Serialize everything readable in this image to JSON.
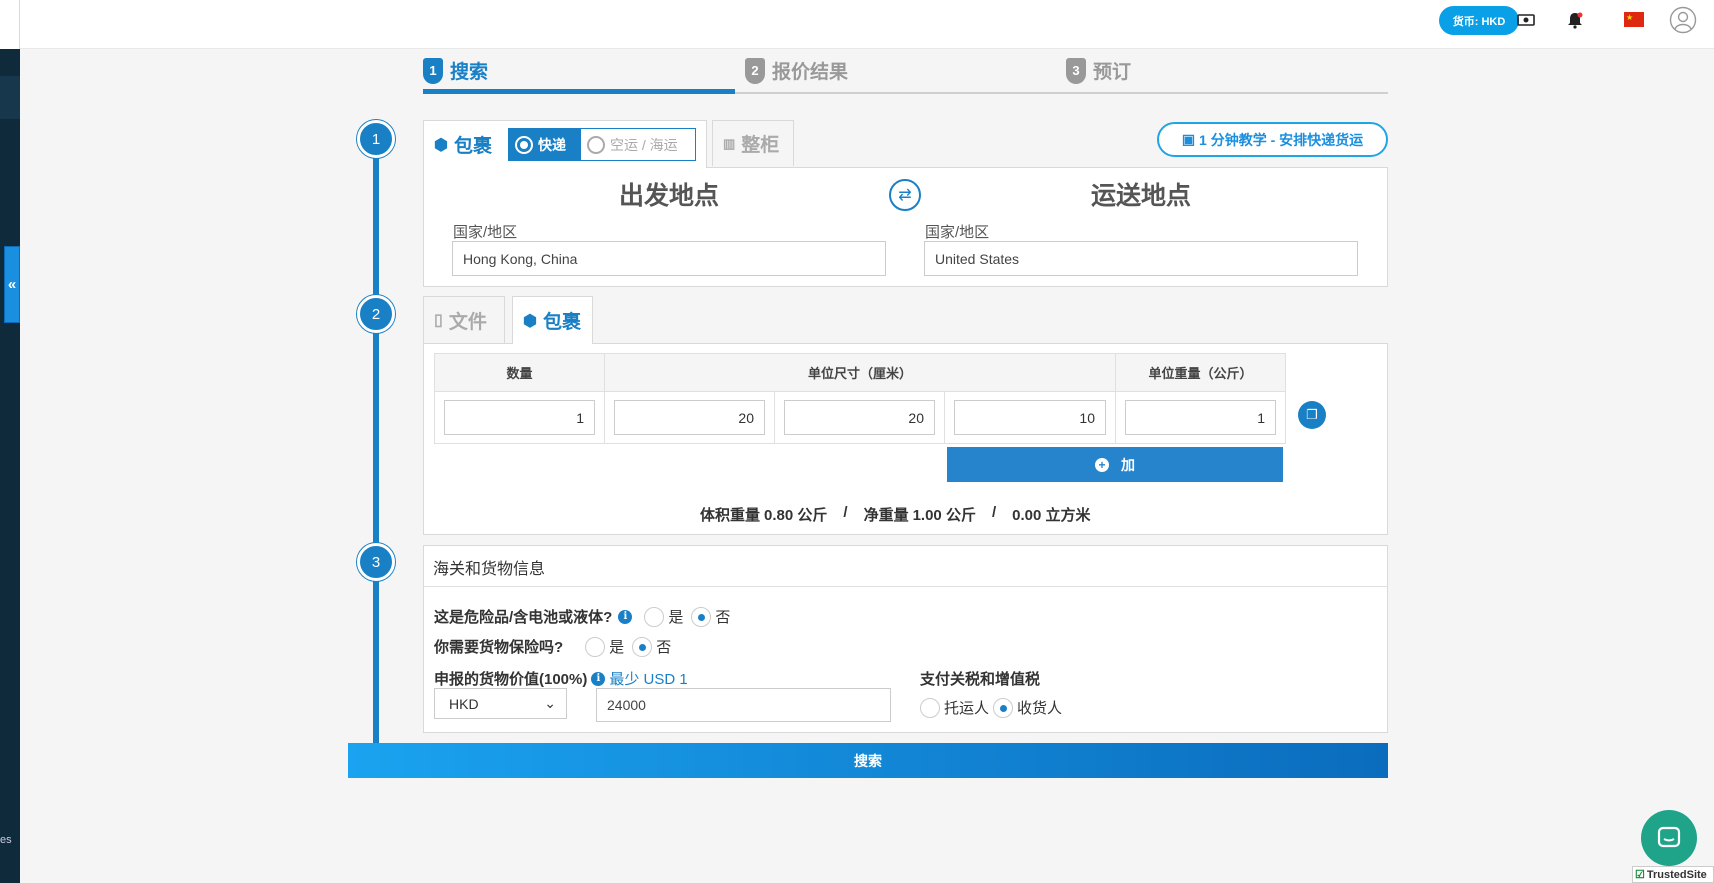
{
  "topbar": {
    "currency": "货币: HKD",
    "icons": [
      "money-icon",
      "bell-icon",
      "china-flag-icon",
      "user-avatar-icon"
    ]
  },
  "sidebar": {
    "truncated_text": "es"
  },
  "steps": [
    {
      "num": "1",
      "label": "搜索",
      "active": true
    },
    {
      "num": "2",
      "label": "报价结果",
      "active": false
    },
    {
      "num": "3",
      "label": "预订",
      "active": false
    }
  ],
  "section1": {
    "num": "1",
    "tab_parcel": "包裹",
    "mode_express": "快递",
    "mode_air_sea": "空运 / 海运",
    "tab_container": "整柜",
    "tutorial": "1 分钟教学 - 安排快递货运",
    "origin_title": "出发地点",
    "dest_title": "运送地点",
    "origin_label": "国家/地区",
    "origin_value": "Hong Kong, China",
    "dest_label": "国家/地区",
    "dest_value": "United States"
  },
  "section2": {
    "num": "2",
    "tab_document": "文件",
    "tab_parcel": "包裹",
    "headers": {
      "qty": "数量",
      "dims": "单位尺寸（厘米）",
      "weight": "单位重量（公斤）"
    },
    "row": {
      "qty": "1",
      "length": "20",
      "width": "20",
      "height": "10",
      "weight": "1"
    },
    "add_label": "加",
    "summary": {
      "vol_label": "体积重量",
      "vol_value": "0.80 公斤",
      "net_label": "净重量",
      "net_value": "1.00 公斤",
      "cbm_value": "0.00 立方米",
      "sep": "/"
    }
  },
  "section3": {
    "num": "3",
    "title": "海关和货物信息",
    "dangerous_q": "这是危险品/含电池或液体?",
    "insurance_q": "你需要货物保险吗?",
    "yes": "是",
    "no": "否",
    "declared_label": "申报的货物价值(100%)",
    "min_label": "最少 USD 1",
    "currency_select": "HKD",
    "declared_value": "24000",
    "duties_label": "支付关税和增值税",
    "shipper": "托运人",
    "consignee": "收货人"
  },
  "search_button": "搜索",
  "trusted_site": "TrustedSite",
  "colors": {
    "primary": "#1a80c6",
    "accent": "#0aa0e8",
    "sidebar": "#0e2a3b",
    "chat": "#1fa389"
  }
}
